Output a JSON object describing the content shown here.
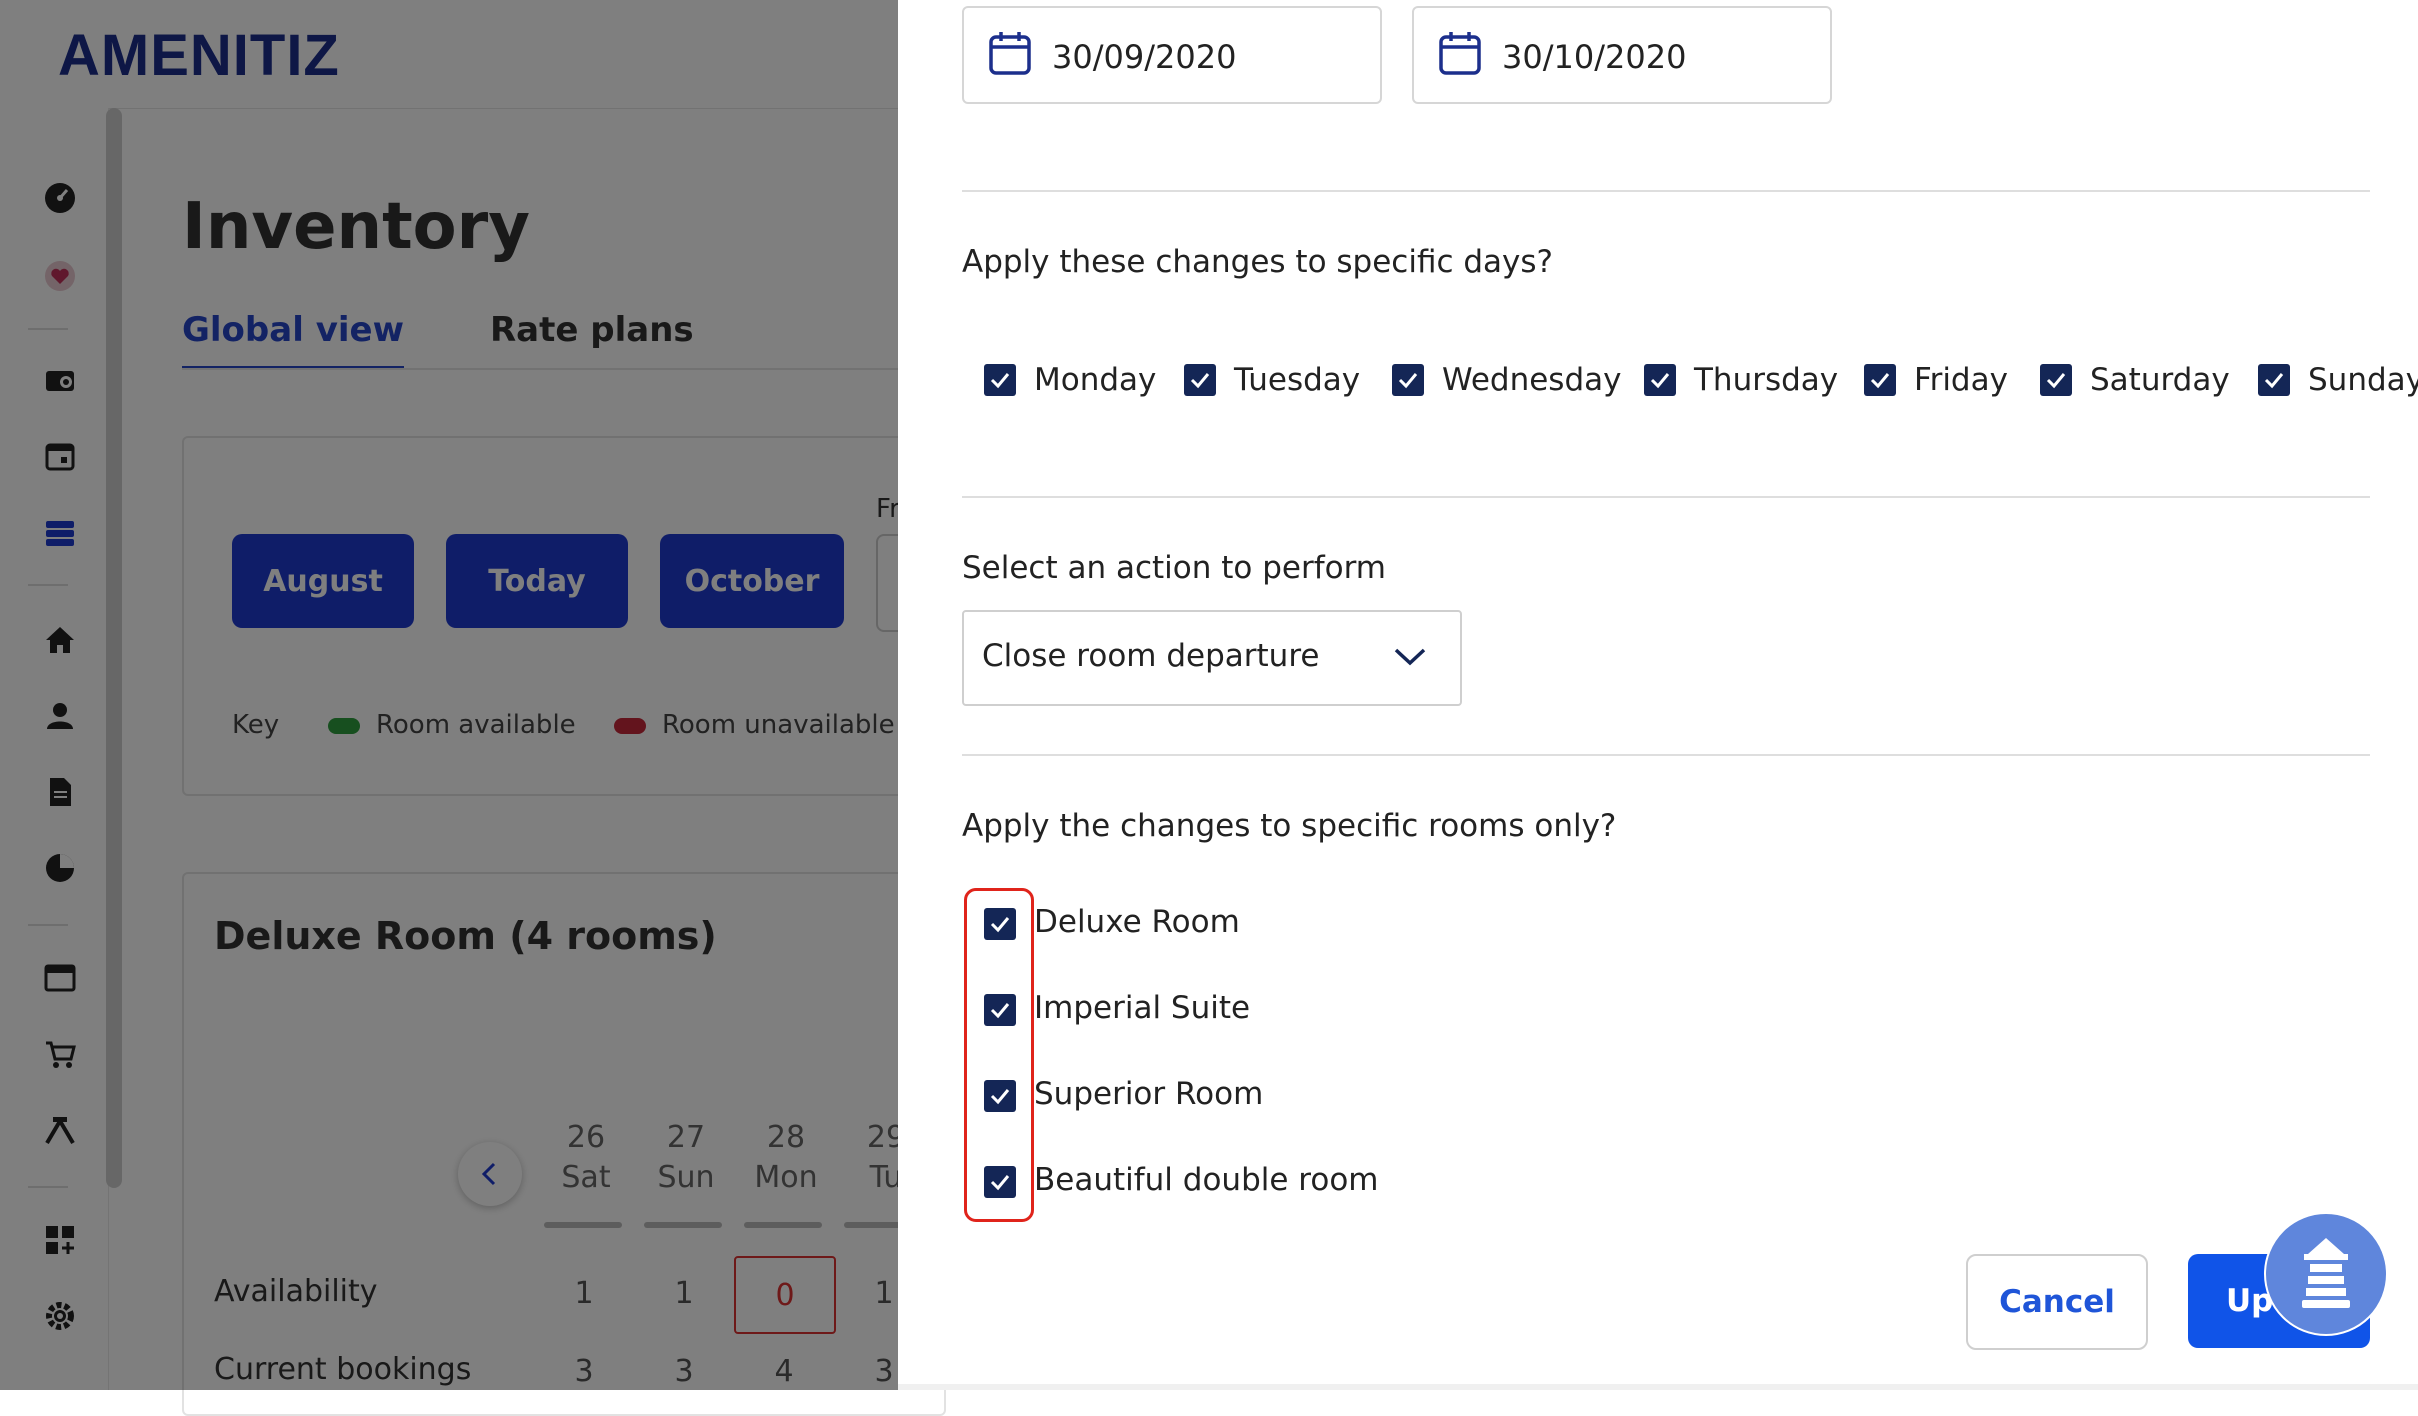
{
  "app": {
    "logo": "AMENITIZ"
  },
  "background": {
    "page_title": "Inventory",
    "tabs": [
      {
        "label": "Global view"
      },
      {
        "label": "Rate plans"
      }
    ],
    "nav_buttons": [
      {
        "label": "August"
      },
      {
        "label": "Today"
      },
      {
        "label": "October"
      }
    ],
    "from_label": "Fr",
    "key": {
      "label": "Key",
      "available": "Room available",
      "unavailable": "Room unavailable",
      "available_color": "#2e9e3f",
      "unavailable_color": "#c6283a"
    },
    "room_card": {
      "title": "Deluxe Room (4 rooms)",
      "days": [
        {
          "num": "26",
          "dow": "Sat"
        },
        {
          "num": "27",
          "dow": "Sun"
        },
        {
          "num": "28",
          "dow": "Mon"
        },
        {
          "num": "29",
          "dow": "Tu"
        }
      ],
      "rows": [
        {
          "label": "Availability",
          "values": [
            "1",
            "1",
            "0",
            "1"
          ]
        },
        {
          "label": "Current bookings",
          "values": [
            "3",
            "3",
            "4",
            "3"
          ]
        }
      ]
    }
  },
  "panel": {
    "date_from": "30/09/2020",
    "date_to": "30/10/2020",
    "days_question": "Apply these changes to specific days?",
    "days": [
      {
        "label": "Monday",
        "checked": true
      },
      {
        "label": "Tuesday",
        "checked": true
      },
      {
        "label": "Wednesday",
        "checked": true
      },
      {
        "label": "Thursday",
        "checked": true
      },
      {
        "label": "Friday",
        "checked": true
      },
      {
        "label": "Saturday",
        "checked": true
      },
      {
        "label": "Sunday",
        "checked": true
      }
    ],
    "action_question": "Select an action to perform",
    "action_selected": "Close room departure",
    "rooms_question": "Apply the changes to specific rooms only?",
    "rooms": [
      {
        "label": "Deluxe Room",
        "checked": true
      },
      {
        "label": "Imperial Suite",
        "checked": true
      },
      {
        "label": "Superior Room",
        "checked": true
      },
      {
        "label": "Beautiful double room",
        "checked": true
      }
    ],
    "cancel_label": "Cancel",
    "update_label": "Update",
    "accent_color": "#1054e8",
    "checkbox_color": "#142656",
    "highlight_color": "#e0241b"
  }
}
